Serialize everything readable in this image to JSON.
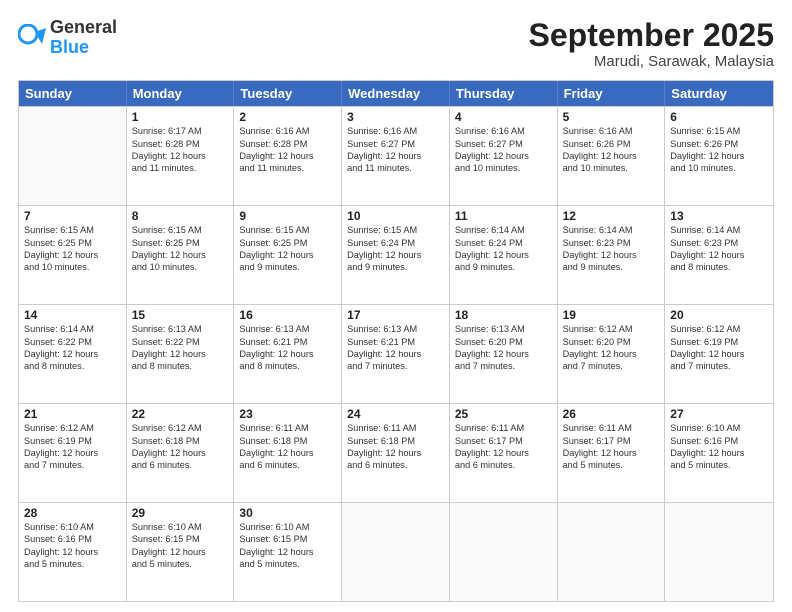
{
  "header": {
    "logo": {
      "general": "General",
      "blue": "Blue"
    },
    "title": "September 2025",
    "location": "Marudi, Sarawak, Malaysia"
  },
  "weekdays": [
    "Sunday",
    "Monday",
    "Tuesday",
    "Wednesday",
    "Thursday",
    "Friday",
    "Saturday"
  ],
  "rows": [
    [
      {
        "day": "",
        "lines": []
      },
      {
        "day": "1",
        "lines": [
          "Sunrise: 6:17 AM",
          "Sunset: 6:28 PM",
          "Daylight: 12 hours",
          "and 11 minutes."
        ]
      },
      {
        "day": "2",
        "lines": [
          "Sunrise: 6:16 AM",
          "Sunset: 6:28 PM",
          "Daylight: 12 hours",
          "and 11 minutes."
        ]
      },
      {
        "day": "3",
        "lines": [
          "Sunrise: 6:16 AM",
          "Sunset: 6:27 PM",
          "Daylight: 12 hours",
          "and 11 minutes."
        ]
      },
      {
        "day": "4",
        "lines": [
          "Sunrise: 6:16 AM",
          "Sunset: 6:27 PM",
          "Daylight: 12 hours",
          "and 10 minutes."
        ]
      },
      {
        "day": "5",
        "lines": [
          "Sunrise: 6:16 AM",
          "Sunset: 6:26 PM",
          "Daylight: 12 hours",
          "and 10 minutes."
        ]
      },
      {
        "day": "6",
        "lines": [
          "Sunrise: 6:15 AM",
          "Sunset: 6:26 PM",
          "Daylight: 12 hours",
          "and 10 minutes."
        ]
      }
    ],
    [
      {
        "day": "7",
        "lines": [
          "Sunrise: 6:15 AM",
          "Sunset: 6:25 PM",
          "Daylight: 12 hours",
          "and 10 minutes."
        ]
      },
      {
        "day": "8",
        "lines": [
          "Sunrise: 6:15 AM",
          "Sunset: 6:25 PM",
          "Daylight: 12 hours",
          "and 10 minutes."
        ]
      },
      {
        "day": "9",
        "lines": [
          "Sunrise: 6:15 AM",
          "Sunset: 6:25 PM",
          "Daylight: 12 hours",
          "and 9 minutes."
        ]
      },
      {
        "day": "10",
        "lines": [
          "Sunrise: 6:15 AM",
          "Sunset: 6:24 PM",
          "Daylight: 12 hours",
          "and 9 minutes."
        ]
      },
      {
        "day": "11",
        "lines": [
          "Sunrise: 6:14 AM",
          "Sunset: 6:24 PM",
          "Daylight: 12 hours",
          "and 9 minutes."
        ]
      },
      {
        "day": "12",
        "lines": [
          "Sunrise: 6:14 AM",
          "Sunset: 6:23 PM",
          "Daylight: 12 hours",
          "and 9 minutes."
        ]
      },
      {
        "day": "13",
        "lines": [
          "Sunrise: 6:14 AM",
          "Sunset: 6:23 PM",
          "Daylight: 12 hours",
          "and 8 minutes."
        ]
      }
    ],
    [
      {
        "day": "14",
        "lines": [
          "Sunrise: 6:14 AM",
          "Sunset: 6:22 PM",
          "Daylight: 12 hours",
          "and 8 minutes."
        ]
      },
      {
        "day": "15",
        "lines": [
          "Sunrise: 6:13 AM",
          "Sunset: 6:22 PM",
          "Daylight: 12 hours",
          "and 8 minutes."
        ]
      },
      {
        "day": "16",
        "lines": [
          "Sunrise: 6:13 AM",
          "Sunset: 6:21 PM",
          "Daylight: 12 hours",
          "and 8 minutes."
        ]
      },
      {
        "day": "17",
        "lines": [
          "Sunrise: 6:13 AM",
          "Sunset: 6:21 PM",
          "Daylight: 12 hours",
          "and 7 minutes."
        ]
      },
      {
        "day": "18",
        "lines": [
          "Sunrise: 6:13 AM",
          "Sunset: 6:20 PM",
          "Daylight: 12 hours",
          "and 7 minutes."
        ]
      },
      {
        "day": "19",
        "lines": [
          "Sunrise: 6:12 AM",
          "Sunset: 6:20 PM",
          "Daylight: 12 hours",
          "and 7 minutes."
        ]
      },
      {
        "day": "20",
        "lines": [
          "Sunrise: 6:12 AM",
          "Sunset: 6:19 PM",
          "Daylight: 12 hours",
          "and 7 minutes."
        ]
      }
    ],
    [
      {
        "day": "21",
        "lines": [
          "Sunrise: 6:12 AM",
          "Sunset: 6:19 PM",
          "Daylight: 12 hours",
          "and 7 minutes."
        ]
      },
      {
        "day": "22",
        "lines": [
          "Sunrise: 6:12 AM",
          "Sunset: 6:18 PM",
          "Daylight: 12 hours",
          "and 6 minutes."
        ]
      },
      {
        "day": "23",
        "lines": [
          "Sunrise: 6:11 AM",
          "Sunset: 6:18 PM",
          "Daylight: 12 hours",
          "and 6 minutes."
        ]
      },
      {
        "day": "24",
        "lines": [
          "Sunrise: 6:11 AM",
          "Sunset: 6:18 PM",
          "Daylight: 12 hours",
          "and 6 minutes."
        ]
      },
      {
        "day": "25",
        "lines": [
          "Sunrise: 6:11 AM",
          "Sunset: 6:17 PM",
          "Daylight: 12 hours",
          "and 6 minutes."
        ]
      },
      {
        "day": "26",
        "lines": [
          "Sunrise: 6:11 AM",
          "Sunset: 6:17 PM",
          "Daylight: 12 hours",
          "and 5 minutes."
        ]
      },
      {
        "day": "27",
        "lines": [
          "Sunrise: 6:10 AM",
          "Sunset: 6:16 PM",
          "Daylight: 12 hours",
          "and 5 minutes."
        ]
      }
    ],
    [
      {
        "day": "28",
        "lines": [
          "Sunrise: 6:10 AM",
          "Sunset: 6:16 PM",
          "Daylight: 12 hours",
          "and 5 minutes."
        ]
      },
      {
        "day": "29",
        "lines": [
          "Sunrise: 6:10 AM",
          "Sunset: 6:15 PM",
          "Daylight: 12 hours",
          "and 5 minutes."
        ]
      },
      {
        "day": "30",
        "lines": [
          "Sunrise: 6:10 AM",
          "Sunset: 6:15 PM",
          "Daylight: 12 hours",
          "and 5 minutes."
        ]
      },
      {
        "day": "",
        "lines": []
      },
      {
        "day": "",
        "lines": []
      },
      {
        "day": "",
        "lines": []
      },
      {
        "day": "",
        "lines": []
      }
    ]
  ]
}
